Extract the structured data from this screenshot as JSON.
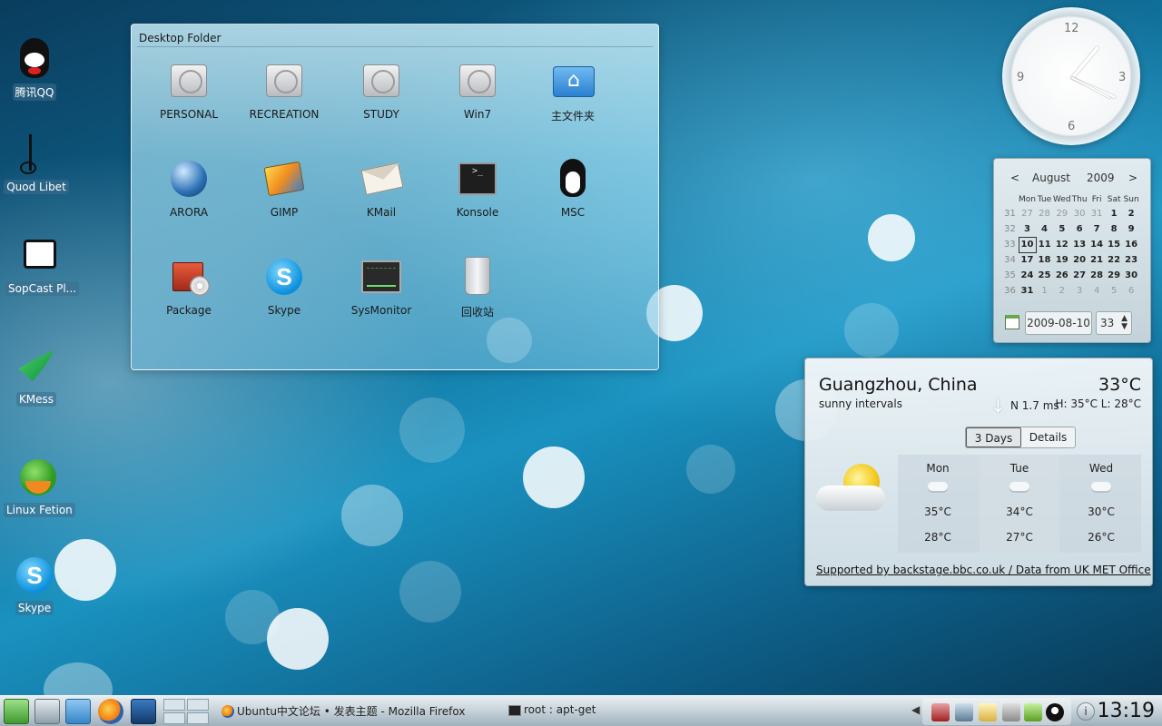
{
  "desktop_icons": [
    {
      "label": "腾讯QQ",
      "icon": "qq-penguin-icon"
    },
    {
      "label": "Quod Libet",
      "icon": "music-note-icon"
    },
    {
      "label": "SopCast Pl...",
      "icon": "tv-icon"
    },
    {
      "label": "KMess",
      "icon": "hummingbird-icon"
    },
    {
      "label": "Linux Fetion",
      "icon": "fetion-icon"
    },
    {
      "label": "Skype",
      "icon": "skype-icon"
    }
  ],
  "folder_view": {
    "title": "Desktop Folder",
    "items": [
      {
        "label": "PERSONAL",
        "icon": "hard-drive-icon"
      },
      {
        "label": "RECREATION",
        "icon": "hard-drive-icon"
      },
      {
        "label": "STUDY",
        "icon": "hard-drive-icon"
      },
      {
        "label": "Win7",
        "icon": "hard-drive-icon"
      },
      {
        "label": "主文件夹",
        "icon": "home-folder-icon"
      },
      {
        "label": "ARORA",
        "icon": "arora-globe-icon"
      },
      {
        "label": "GIMP",
        "icon": "gimp-icon"
      },
      {
        "label": "KMail",
        "icon": "mail-icon"
      },
      {
        "label": "Konsole",
        "icon": "terminal-icon"
      },
      {
        "label": "MSC",
        "icon": "tux-penguin-icon"
      },
      {
        "label": "Package",
        "icon": "package-icon"
      },
      {
        "label": "Skype",
        "icon": "skype-icon"
      },
      {
        "label": "SysMonitor",
        "icon": "system-monitor-icon"
      },
      {
        "label": "回收站",
        "icon": "trash-icon"
      }
    ]
  },
  "clock": {
    "numbers": [
      "12",
      "3",
      "6",
      "9"
    ]
  },
  "calendar": {
    "prev": "<",
    "month": "August",
    "year": "2009",
    "next": ">",
    "weekdays": [
      "Mon",
      "Tue",
      "Wed",
      "Thu",
      "Fri",
      "Sat",
      "Sun"
    ],
    "weeks": [
      {
        "wk": "31",
        "days": [
          "27",
          "28",
          "29",
          "30",
          "31",
          "1",
          "2"
        ]
      },
      {
        "wk": "32",
        "days": [
          "3",
          "4",
          "5",
          "6",
          "7",
          "8",
          "9"
        ]
      },
      {
        "wk": "33",
        "days": [
          "10",
          "11",
          "12",
          "13",
          "14",
          "15",
          "16"
        ]
      },
      {
        "wk": "34",
        "days": [
          "17",
          "18",
          "19",
          "20",
          "21",
          "22",
          "23"
        ]
      },
      {
        "wk": "35",
        "days": [
          "24",
          "25",
          "26",
          "27",
          "28",
          "29",
          "30"
        ]
      },
      {
        "wk": "36",
        "days": [
          "31",
          "1",
          "2",
          "3",
          "4",
          "5",
          "6"
        ]
      }
    ],
    "selected_date": "2009-08-10",
    "week_number": "33"
  },
  "weather": {
    "location": "Guangzhou, China",
    "temperature": "33°C",
    "condition": "sunny intervals",
    "wind": "N 1.7 ms",
    "high_low": "H: 35°C  L: 28°C",
    "tabs": [
      "3 Days",
      "Details"
    ],
    "active_tab": "3 Days",
    "forecast": [
      {
        "day": "Mon",
        "high": "35°C",
        "low": "28°C"
      },
      {
        "day": "Tue",
        "high": "34°C",
        "low": "27°C"
      },
      {
        "day": "Wed",
        "high": "30°C",
        "low": "26°C"
      }
    ],
    "footer": "Supported by backstage.bbc.co.uk / Data from UK MET Office"
  },
  "taskbar": {
    "tasks": [
      {
        "label": "Ubuntu中文论坛 • 发表主题 - Mozilla Firefox",
        "icon": "firefox-icon"
      },
      {
        "label": "root : apt-get",
        "icon": "terminal-icon"
      }
    ],
    "time": "13:19"
  }
}
